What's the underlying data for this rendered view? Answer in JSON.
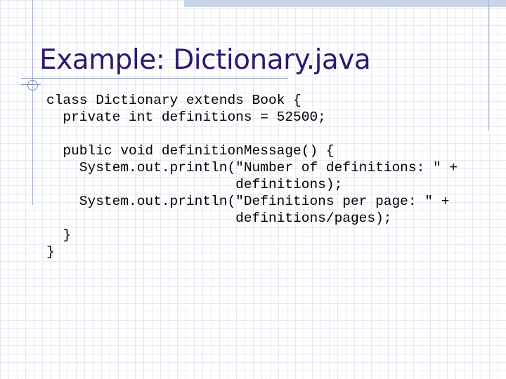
{
  "slide": {
    "title": "Example: Dictionary.java",
    "code_lines": [
      "class Dictionary extends Book {",
      "  private int definitions = 52500;",
      "",
      "  public void definitionMessage() {",
      "    System.out.println(\"Number of definitions: \" +",
      "                       definitions);",
      "    System.out.println(\"Definitions per page: \" +",
      "                       definitions/pages);",
      "  }",
      "}"
    ]
  }
}
